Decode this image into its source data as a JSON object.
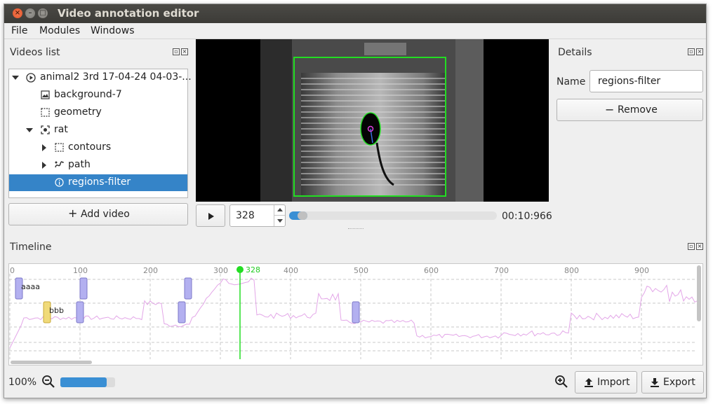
{
  "window": {
    "title": "Video annotation editor"
  },
  "menu": [
    "File",
    "Modules",
    "Windows"
  ],
  "videos_panel": {
    "title": "Videos list",
    "tree": [
      {
        "label": "animal2 3rd 17-04-24 04-03-...",
        "icon": "play-circle-icon",
        "expanded": true
      },
      {
        "label": "background-7",
        "icon": "image-icon"
      },
      {
        "label": "geometry",
        "icon": "dashed-square-icon"
      },
      {
        "label": "rat",
        "icon": "target-icon",
        "expanded": true
      },
      {
        "label": "contours",
        "icon": "dashed-square-icon",
        "collapsed": true
      },
      {
        "label": "path",
        "icon": "path-icon",
        "collapsed": true
      },
      {
        "label": "regions-filter",
        "icon": "info-icon",
        "selected": true
      }
    ],
    "add_video": "Add video"
  },
  "player": {
    "frame": "328",
    "time": "00:10:966",
    "progress": 0.055
  },
  "details": {
    "title": "Details",
    "name_label": "Name",
    "name_value": "regions-filter",
    "remove_label": "Remove"
  },
  "timeline": {
    "title": "Timeline",
    "ticks": [
      "0",
      "100",
      "200",
      "300",
      "400",
      "500",
      "600",
      "700",
      "800",
      "900"
    ],
    "cursor_label": "328",
    "cursor_frame": 328,
    "tracks": [
      {
        "label": "aaaa",
        "color": "#b3b0f0",
        "marks": [
          12,
          104,
          253
        ]
      },
      {
        "label": "bbb",
        "color": "#f0da7a",
        "marks": [
          52
        ]
      },
      {
        "label": "",
        "color": "#b3b0f0",
        "marks": [
          99,
          244,
          492
        ]
      }
    ]
  },
  "bottom": {
    "zoom": "100%",
    "zoom_level": 0.85,
    "import_label": "Import",
    "export_label": "Export"
  },
  "colors": {
    "accent": "#3584c8",
    "green": "#22dd22",
    "track_purple": "#b3b0f0",
    "track_yellow": "#f0da7a"
  }
}
